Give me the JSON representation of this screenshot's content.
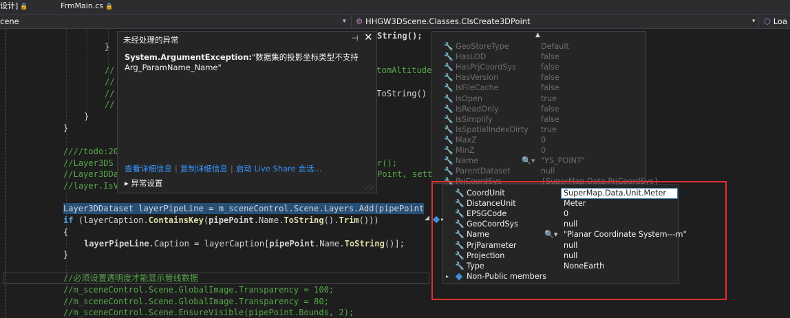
{
  "tabs": [
    {
      "label": "设计]",
      "lock": "🔒"
    },
    {
      "label": "FrmMain.cs",
      "lock": "🔒"
    }
  ],
  "nav": {
    "left": "cene",
    "class_path": "HHGW3DScene.Classes.ClsCreate3DPoint",
    "right": "Loa"
  },
  "code": {
    "l1": "String();",
    "l2": "}",
    "l3": "//",
    "l3b": "ttomAltitude",
    "l4": "//",
    "l5": "//",
    "l5b": ".ToString()",
    "l6": "//",
    "l7": "}",
    "l8": "}",
    "l9": "////todo:20",
    "l10": "//Layer3DS",
    "l10b": "r();",
    "l11": "//Layer3DDa",
    "l11b": "Point, sett",
    "l12": "//layer.IsV",
    "l13_a": "Layer3DDataset",
    "l13_b": " layerPipeLine = m_sceneControl.Scene.Layers.Add(pipePoint",
    "l14_kw": "if",
    "l14_a": " (layerCaption.",
    "l14_m": "ContainsKey",
    "l14_b": "(",
    "l14_v": "pipePoint",
    "l14_c": ".Name.",
    "l14_m2": "ToString",
    "l14_d": "().",
    "l14_m3": "Trim",
    "l14_e": "()))",
    "l15": "{",
    "l16_v": "layerPipeLine",
    "l16_a": ".Caption = layerCaption[",
    "l16_v2": "pipePoint",
    "l16_b": ".Name.",
    "l16_m": "ToString",
    "l16_c": "()];",
    "l17": "}",
    "l18": "//必须设置透明度才能显示管线数据",
    "l19": "//m_sceneControl.Scene.GlobalImage.Transparency = 100;",
    "l20": "//m_sceneControl.Scene.GlobalImage.Transparency = 80;",
    "l21": "//m_sceneControl.Scene.EnsureVisible(pipePoint.Bounds, 2);"
  },
  "exception": {
    "title": "未经处理的异常",
    "pin": "⊣",
    "close": "✕",
    "type": "System.ArgumentException:",
    "message": "\"数据集的投影坐标类型不支持",
    "message2": "Arg_ParamName_Name\"",
    "link_details": "查看详细信息",
    "link_copy": "复制详细信息",
    "link_liveshare": "启动 Live Share 会话...",
    "settings": "▸ 异常设置"
  },
  "datatip_bg": [
    {
      "name": "GeoStoreType",
      "value": "Default"
    },
    {
      "name": "HasLOD",
      "value": "false"
    },
    {
      "name": "HasPrjCoordSys",
      "value": "false"
    },
    {
      "name": "HasVersion",
      "value": "false"
    },
    {
      "name": "IsFileCache",
      "value": "false"
    },
    {
      "name": "IsOpen",
      "value": "true"
    },
    {
      "name": "IsReadOnly",
      "value": "false"
    },
    {
      "name": "IsSimplify",
      "value": "false"
    },
    {
      "name": "IsSpatialIndexDirty",
      "value": "true"
    },
    {
      "name": "MaxZ",
      "value": "0"
    },
    {
      "name": "MinZ",
      "value": "0"
    },
    {
      "name": "Name",
      "value": "\"YS_POINT\""
    },
    {
      "name": "ParentDataset",
      "value": "null"
    },
    {
      "name": "PrjCoordSys",
      "value": "{SuperMap.Data.PrjCoordSys}"
    }
  ],
  "datatip_fg": [
    {
      "name": "CoordUnit",
      "value": "SuperMap.Data.Unit.Meter"
    },
    {
      "name": "DistanceUnit",
      "value": "Meter"
    },
    {
      "name": "EPSGCode",
      "value": "0"
    },
    {
      "name": "GeoCoordSys",
      "value": "null"
    },
    {
      "name": "Name",
      "value": "\"Planar Coordinate System---m\""
    },
    {
      "name": "PrjParameter",
      "value": "null"
    },
    {
      "name": "Projection",
      "value": "null"
    },
    {
      "name": "Type",
      "value": "NoneEarth"
    },
    {
      "name": "Non-Public members",
      "value": ""
    }
  ],
  "colors": {
    "accent_link": "#3794ff",
    "highlight_box": "#e0312c",
    "selection": "#264f78"
  }
}
